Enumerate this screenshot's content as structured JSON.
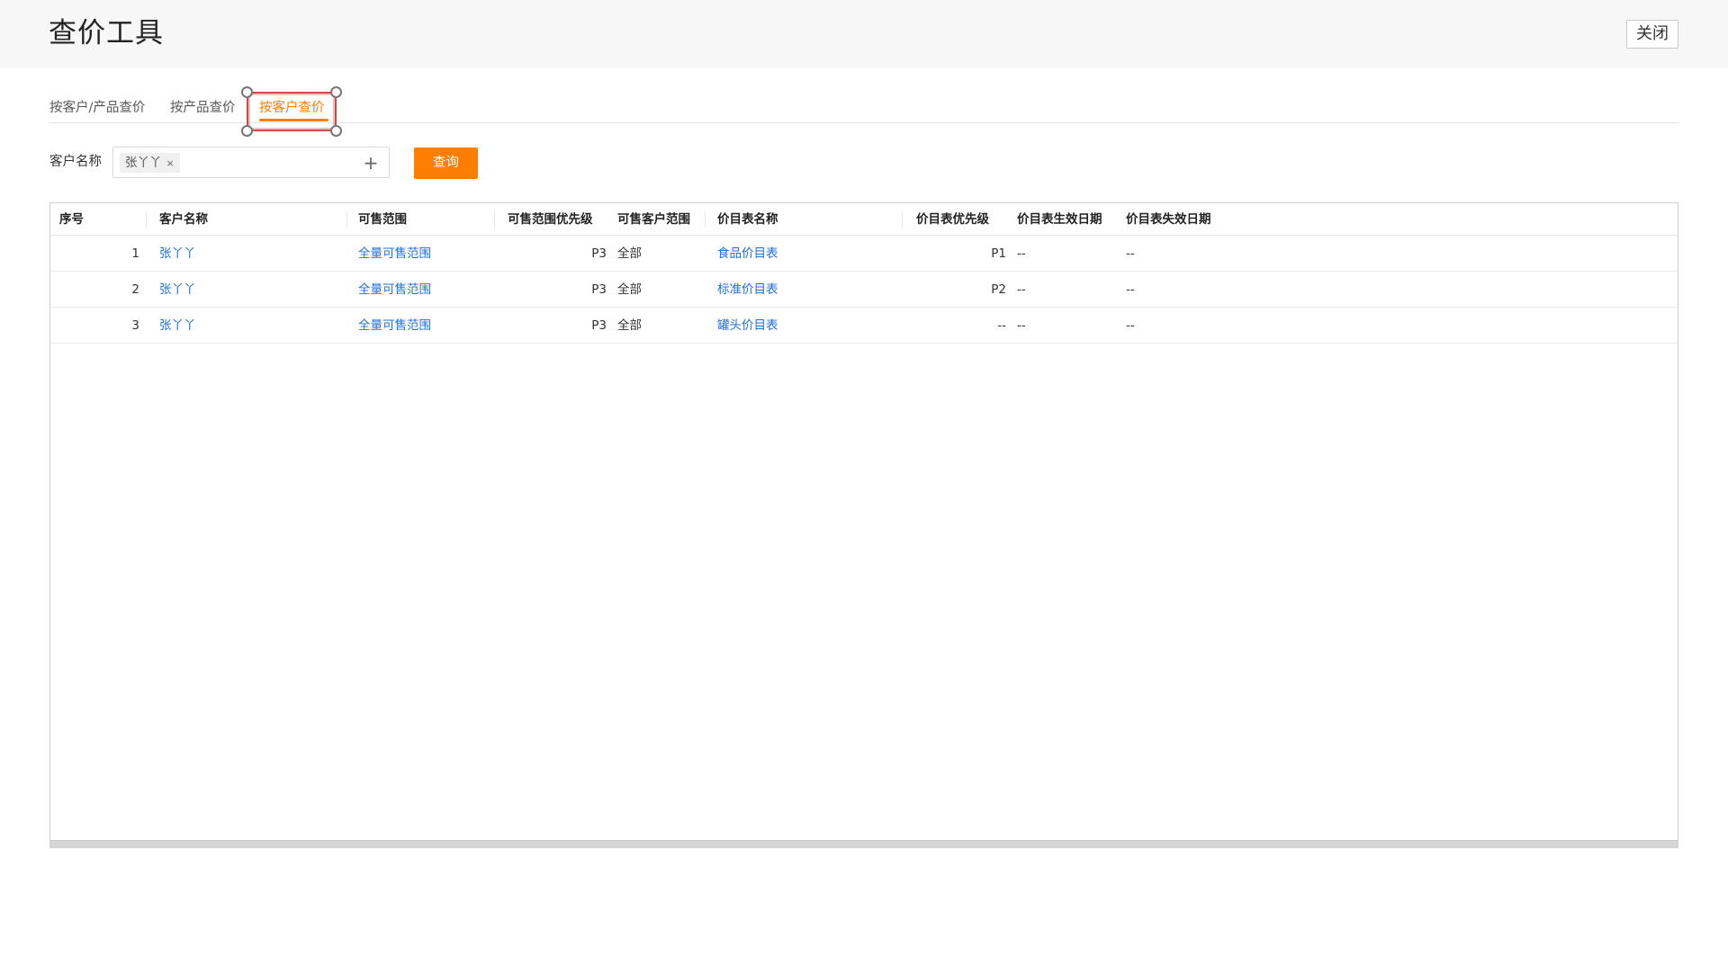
{
  "header": {
    "title": "查价工具",
    "close_label": "关闭"
  },
  "tabs": [
    {
      "label": "按客户/产品查价",
      "active": false
    },
    {
      "label": "按产品查价",
      "active": false
    },
    {
      "label": "按客户查价",
      "active": true
    }
  ],
  "filter": {
    "label": "客户名称",
    "selected_tag": "张丫丫",
    "tag_remove": "×",
    "add_symbol": "+",
    "query_label": "查询"
  },
  "table": {
    "columns": [
      "序号",
      "客户名称",
      "可售范围",
      "可售范围优先级",
      "可售客户范围",
      "价目表名称",
      "价目表优先级",
      "价目表生效日期",
      "价目表失效日期"
    ],
    "rows": [
      {
        "index": "1",
        "customer": "张丫丫",
        "range": "全量可售范围",
        "range_priority": "P3",
        "customer_range": "全部",
        "price_list": "食品价目表",
        "price_priority": "P1",
        "effective": "--",
        "expire": "--"
      },
      {
        "index": "2",
        "customer": "张丫丫",
        "range": "全量可售范围",
        "range_priority": "P3",
        "customer_range": "全部",
        "price_list": "标准价目表",
        "price_priority": "P2",
        "effective": "--",
        "expire": "--"
      },
      {
        "index": "3",
        "customer": "张丫丫",
        "range": "全量可售范围",
        "range_priority": "P3",
        "customer_range": "全部",
        "price_list": "罐头价目表",
        "price_priority": "--",
        "effective": "--",
        "expire": "--"
      }
    ]
  },
  "colors": {
    "accent": "#ff7d00",
    "link": "#1f6fd6",
    "selection": "#c9504a"
  }
}
